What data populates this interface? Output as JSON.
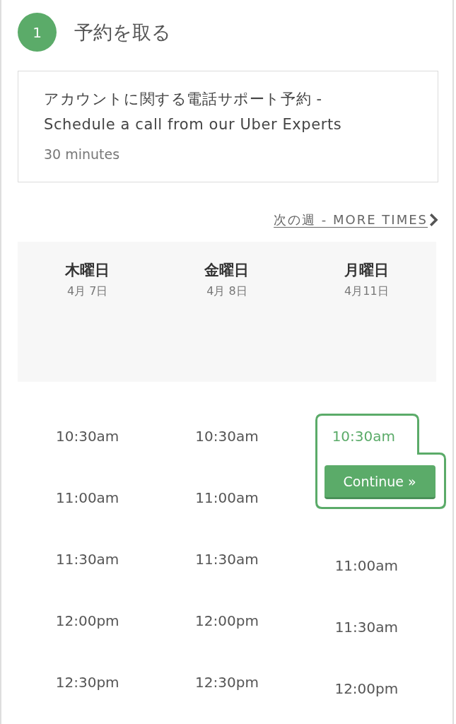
{
  "step": {
    "number": "1",
    "title": "予約を取る"
  },
  "event": {
    "title_lines": [
      "アカウントに関する電話サポート予約 -",
      "Schedule a call from our Uber Experts"
    ],
    "duration": "30 minutes"
  },
  "next_link": "次の週 - MORE TIMES",
  "continue_button": "Continue »",
  "days": [
    {
      "name": "木曜日",
      "date": "4月 7日",
      "slots": [
        {
          "time": "10:30am",
          "selected": false
        },
        {
          "time": "11:00am",
          "selected": false
        },
        {
          "time": "11:30am",
          "selected": false
        },
        {
          "time": "12:00pm",
          "selected": false
        },
        {
          "time": "12:30pm",
          "selected": false
        }
      ]
    },
    {
      "name": "金曜日",
      "date": "4月 8日",
      "slots": [
        {
          "time": "10:30am",
          "selected": false
        },
        {
          "time": "11:00am",
          "selected": false
        },
        {
          "time": "11:30am",
          "selected": false
        },
        {
          "time": "12:00pm",
          "selected": false
        },
        {
          "time": "12:30pm",
          "selected": false
        }
      ]
    },
    {
      "name": "月曜日",
      "date": "4月11日",
      "slots": [
        {
          "time": "10:30am",
          "selected": true
        },
        {
          "time": "11:00am",
          "selected": false
        },
        {
          "time": "11:30am",
          "selected": false
        },
        {
          "time": "12:00pm",
          "selected": false
        }
      ]
    }
  ]
}
